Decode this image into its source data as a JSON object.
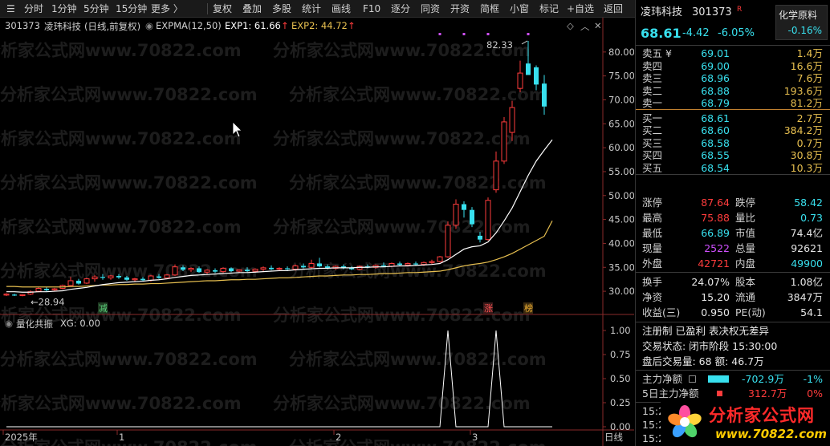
{
  "toolbar": {
    "left_items": [
      "分时",
      "1分钟",
      "5分钟",
      "15分钟",
      "更多 〉"
    ],
    "right_items": [
      "复权",
      "叠加",
      "多股",
      "统计",
      "画线",
      "F10",
      "逐分",
      "同资",
      "开资",
      "简框",
      "小窗",
      "标记",
      "+自选",
      "返回"
    ]
  },
  "legend": {
    "code": "301373",
    "name": "凌玮科技",
    "period": "(日线,前复权)",
    "indicator": "EXPMA(12,50)",
    "exp1": "EXP1: 61.66",
    "exp2": "EXP2: 44.72",
    "up_arrow": "↑"
  },
  "sub_legend": {
    "name": "量化共振",
    "value": "XG: 0.00"
  },
  "watermark": "分析家公式网www.70822.com",
  "chart_labels": {
    "high_label": "82.33",
    "low_label": "←28.94",
    "tag_jian": "减",
    "tag_zhang": "涨",
    "tag_bang": "榜"
  },
  "time_axis": [
    "2025年",
    "1",
    "2",
    "3"
  ],
  "time_axis_end": "日线",
  "chart_data": {
    "type": "candlestick",
    "price_axis": {
      "ticks": [
        30.0,
        35.0,
        40.0,
        45.0,
        50.0,
        55.0,
        60.0,
        65.0,
        70.0,
        75.0,
        80.0
      ]
    },
    "sub_axis": {
      "ticks": [
        0.0,
        0.25,
        0.5,
        0.75,
        1.0
      ]
    },
    "candles": [
      {
        "o": 29.2,
        "h": 29.6,
        "l": 29.0,
        "c": 29.4
      },
      {
        "o": 29.3,
        "h": 29.5,
        "l": 29.0,
        "c": 29.1
      },
      {
        "o": 29.1,
        "h": 29.4,
        "l": 28.94,
        "c": 29.3
      },
      {
        "o": 29.4,
        "h": 30.2,
        "l": 29.2,
        "c": 29.9
      },
      {
        "o": 30.0,
        "h": 30.8,
        "l": 29.8,
        "c": 30.6
      },
      {
        "o": 30.5,
        "h": 30.9,
        "l": 30.0,
        "c": 30.2
      },
      {
        "o": 30.3,
        "h": 30.7,
        "l": 30.0,
        "c": 30.5
      },
      {
        "o": 30.6,
        "h": 31.4,
        "l": 30.4,
        "c": 31.2
      },
      {
        "o": 31.2,
        "h": 33.0,
        "l": 31.0,
        "c": 32.2
      },
      {
        "o": 32.2,
        "h": 32.6,
        "l": 31.4,
        "c": 31.6
      },
      {
        "o": 31.7,
        "h": 32.8,
        "l": 31.5,
        "c": 32.6
      },
      {
        "o": 32.6,
        "h": 33.4,
        "l": 32.0,
        "c": 33.0
      },
      {
        "o": 33.0,
        "h": 33.6,
        "l": 32.4,
        "c": 32.8
      },
      {
        "o": 32.8,
        "h": 33.4,
        "l": 32.4,
        "c": 33.2
      },
      {
        "o": 33.2,
        "h": 33.6,
        "l": 32.6,
        "c": 32.9
      },
      {
        "o": 32.9,
        "h": 33.2,
        "l": 32.2,
        "c": 32.4
      },
      {
        "o": 32.4,
        "h": 32.8,
        "l": 32.0,
        "c": 32.6
      },
      {
        "o": 32.6,
        "h": 33.0,
        "l": 32.1,
        "c": 32.3
      },
      {
        "o": 32.3,
        "h": 33.4,
        "l": 32.0,
        "c": 33.2
      },
      {
        "o": 33.1,
        "h": 33.6,
        "l": 32.6,
        "c": 32.8
      },
      {
        "o": 32.8,
        "h": 33.6,
        "l": 32.5,
        "c": 33.4
      },
      {
        "o": 33.4,
        "h": 35.6,
        "l": 33.2,
        "c": 35.1
      },
      {
        "o": 35.0,
        "h": 35.4,
        "l": 34.2,
        "c": 34.5
      },
      {
        "o": 34.5,
        "h": 35.0,
        "l": 34.0,
        "c": 34.8
      },
      {
        "o": 34.8,
        "h": 35.2,
        "l": 33.8,
        "c": 34.0
      },
      {
        "o": 34.0,
        "h": 34.6,
        "l": 33.6,
        "c": 34.4
      },
      {
        "o": 34.4,
        "h": 34.8,
        "l": 33.8,
        "c": 34.1
      },
      {
        "o": 34.1,
        "h": 35.0,
        "l": 33.8,
        "c": 34.8
      },
      {
        "o": 34.8,
        "h": 35.0,
        "l": 34.0,
        "c": 34.2
      },
      {
        "o": 34.2,
        "h": 34.6,
        "l": 33.8,
        "c": 34.5
      },
      {
        "o": 34.5,
        "h": 35.0,
        "l": 34.0,
        "c": 34.2
      },
      {
        "o": 34.2,
        "h": 34.8,
        "l": 33.9,
        "c": 34.6
      },
      {
        "o": 34.6,
        "h": 35.2,
        "l": 34.2,
        "c": 34.9
      },
      {
        "o": 34.9,
        "h": 35.4,
        "l": 34.4,
        "c": 34.6
      },
      {
        "o": 34.6,
        "h": 35.0,
        "l": 34.3,
        "c": 34.8
      },
      {
        "o": 34.8,
        "h": 35.2,
        "l": 34.4,
        "c": 34.6
      },
      {
        "o": 34.6,
        "h": 35.6,
        "l": 34.3,
        "c": 35.3
      },
      {
        "o": 35.3,
        "h": 35.8,
        "l": 34.8,
        "c": 35.0
      },
      {
        "o": 35.0,
        "h": 36.6,
        "l": 34.8,
        "c": 35.8
      },
      {
        "o": 35.8,
        "h": 37.0,
        "l": 35.0,
        "c": 35.2
      },
      {
        "o": 35.2,
        "h": 35.6,
        "l": 34.6,
        "c": 34.8
      },
      {
        "o": 34.8,
        "h": 35.4,
        "l": 34.5,
        "c": 35.2
      },
      {
        "o": 35.2,
        "h": 35.6,
        "l": 34.6,
        "c": 34.9
      },
      {
        "o": 34.9,
        "h": 35.2,
        "l": 34.4,
        "c": 34.6
      },
      {
        "o": 34.6,
        "h": 35.4,
        "l": 34.4,
        "c": 35.2
      },
      {
        "o": 35.2,
        "h": 35.6,
        "l": 34.8,
        "c": 35.0
      },
      {
        "o": 35.0,
        "h": 35.6,
        "l": 34.7,
        "c": 35.4
      },
      {
        "o": 35.4,
        "h": 36.0,
        "l": 35.0,
        "c": 35.2
      },
      {
        "o": 35.2,
        "h": 36.0,
        "l": 35.0,
        "c": 35.8
      },
      {
        "o": 35.8,
        "h": 36.2,
        "l": 35.2,
        "c": 35.5
      },
      {
        "o": 35.5,
        "h": 36.0,
        "l": 35.2,
        "c": 35.8
      },
      {
        "o": 35.8,
        "h": 36.2,
        "l": 35.4,
        "c": 35.6
      },
      {
        "o": 35.6,
        "h": 36.2,
        "l": 35.3,
        "c": 36.0
      },
      {
        "o": 36.0,
        "h": 36.6,
        "l": 35.6,
        "c": 36.2
      },
      {
        "o": 36.2,
        "h": 37.4,
        "l": 36.0,
        "c": 37.2
      },
      {
        "o": 37.2,
        "h": 44.6,
        "l": 37.0,
        "c": 43.8
      },
      {
        "o": 43.8,
        "h": 49.2,
        "l": 43.0,
        "c": 48.2
      },
      {
        "o": 48.2,
        "h": 48.8,
        "l": 45.4,
        "c": 47.0
      },
      {
        "o": 47.0,
        "h": 47.6,
        "l": 43.4,
        "c": 44.0
      },
      {
        "o": 41.6,
        "h": 42.4,
        "l": 40.2,
        "c": 40.8
      },
      {
        "o": 40.8,
        "h": 49.6,
        "l": 40.6,
        "c": 49.0
      },
      {
        "o": 51.2,
        "h": 59.2,
        "l": 50.6,
        "c": 57.2
      },
      {
        "o": 57.2,
        "h": 66.4,
        "l": 56.6,
        "c": 65.4
      },
      {
        "o": 63.2,
        "h": 69.8,
        "l": 61.4,
        "c": 68.4
      },
      {
        "o": 72.4,
        "h": 78.2,
        "l": 71.6,
        "c": 75.6
      },
      {
        "o": 77.6,
        "h": 82.33,
        "l": 75.4,
        "c": 75.2
      },
      {
        "o": 76.8,
        "h": 77.2,
        "l": 72.0,
        "c": 73.2
      },
      {
        "o": 73.4,
        "h": 75.2,
        "l": 66.89,
        "c": 68.61
      }
    ],
    "exp1": [
      29.9,
      29.9,
      29.8,
      29.8,
      29.9,
      29.9,
      30.0,
      30.1,
      30.4,
      30.6,
      30.8,
      31.1,
      31.4,
      31.6,
      31.8,
      31.9,
      32.0,
      32.1,
      32.3,
      32.4,
      32.6,
      32.9,
      33.1,
      33.3,
      33.4,
      33.5,
      33.6,
      33.7,
      33.8,
      33.9,
      33.9,
      34.0,
      34.1,
      34.2,
      34.3,
      34.3,
      34.5,
      34.6,
      34.7,
      34.8,
      34.8,
      34.9,
      34.9,
      34.9,
      35.0,
      35.0,
      35.1,
      35.1,
      35.2,
      35.3,
      35.3,
      35.4,
      35.5,
      35.6,
      35.8,
      36.6,
      37.7,
      38.8,
      39.3,
      39.5,
      40.3,
      42.2,
      44.7,
      47.4,
      50.8,
      54.2,
      57.2,
      59.5,
      61.66
    ],
    "exp2": [
      31.0,
      31.0,
      30.9,
      30.9,
      30.9,
      30.9,
      30.9,
      30.9,
      31.0,
      31.0,
      31.1,
      31.2,
      31.3,
      31.3,
      31.4,
      31.4,
      31.5,
      31.5,
      31.6,
      31.6,
      31.7,
      31.8,
      31.9,
      32.0,
      32.1,
      32.2,
      32.2,
      32.3,
      32.4,
      32.4,
      32.5,
      32.5,
      32.6,
      32.7,
      32.8,
      32.8,
      32.9,
      33.0,
      33.1,
      33.2,
      33.2,
      33.3,
      33.4,
      33.4,
      33.5,
      33.5,
      33.6,
      33.7,
      33.7,
      33.8,
      33.9,
      33.9,
      34.0,
      34.1,
      34.2,
      34.5,
      34.9,
      35.3,
      35.6,
      35.8,
      36.1,
      36.6,
      37.2,
      37.9,
      38.8,
      39.7,
      40.6,
      41.5,
      44.72
    ],
    "signal": [
      0,
      0,
      0,
      0,
      0,
      0,
      0,
      0,
      0,
      0,
      0,
      0,
      0,
      0,
      0,
      0,
      0,
      0,
      0,
      0,
      0,
      0,
      0,
      0,
      0,
      0,
      0,
      0,
      0,
      0,
      0,
      0,
      0,
      0,
      0,
      0,
      0,
      0,
      0,
      0,
      0,
      0,
      0,
      0,
      0,
      0,
      0,
      0,
      0,
      0,
      0,
      0,
      0,
      0,
      0,
      1,
      0,
      0,
      0,
      0,
      0,
      1,
      0,
      0,
      0,
      0,
      0,
      0,
      0
    ]
  },
  "quote": {
    "name": "凌玮科技",
    "code": "301373",
    "r_badge": "R",
    "sector": "化学原料",
    "sector_change": "-0.16%",
    "price": "68.61",
    "change": "-4.42",
    "change_pct": "-6.05%",
    "sells": [
      {
        "label": "卖五 ¥",
        "price": "69.01",
        "vol": "1.4万"
      },
      {
        "label": "卖四",
        "price": "69.00",
        "vol": "16.6万"
      },
      {
        "label": "卖三",
        "price": "68.96",
        "vol": "7.6万"
      },
      {
        "label": "卖二",
        "price": "68.88",
        "vol": "193.6万"
      },
      {
        "label": "卖一",
        "price": "68.79",
        "vol": "81.2万"
      }
    ],
    "buys": [
      {
        "label": "买一",
        "price": "68.61",
        "vol": "2.7万"
      },
      {
        "label": "买二",
        "price": "68.60",
        "vol": "384.2万"
      },
      {
        "label": "买三",
        "price": "68.58",
        "vol": "0.7万"
      },
      {
        "label": "买四",
        "price": "68.55",
        "vol": "30.8万"
      },
      {
        "label": "买五",
        "price": "68.54",
        "vol": "10.3万"
      }
    ],
    "stats1": [
      {
        "l1": "涨停",
        "v1": "87.64",
        "c1": "red",
        "l2": "跌停",
        "v2": "58.42",
        "c2": "cyan"
      },
      {
        "l1": "最高",
        "v1": "75.88",
        "c1": "red",
        "l2": "量比",
        "v2": "0.73",
        "c2": "cyan"
      },
      {
        "l1": "最低",
        "v1": "66.89",
        "c1": "cyan",
        "l2": "市值",
        "v2": "74.4亿",
        "c2": "white"
      },
      {
        "l1": "现量",
        "v1": "2522",
        "c1": "purple",
        "l2": "总量",
        "v2": "92621",
        "c2": "white"
      },
      {
        "l1": "外盘",
        "v1": "42721",
        "c1": "red",
        "l2": "内盘",
        "v2": "49900",
        "c2": "cyan"
      }
    ],
    "stats2": [
      {
        "l1": "换手",
        "v1": "24.07%",
        "l2": "股本",
        "v2": "1.08亿"
      },
      {
        "l1": "净资",
        "v1": "15.20",
        "l2": "流通",
        "v2": "3847万"
      },
      {
        "l1": "收益(三)",
        "v1": "0.950",
        "l2": "PE(动)",
        "v2": "54.1"
      }
    ],
    "info_line1": "注册制 已盈利 表决权无差异",
    "info_line2": "交易状态: 闭市阶段 15:30:00",
    "info_line3_prefix": "盘后交易量: 68  额: 46.7万",
    "main_flow_label": "主力净额",
    "main_flow_value": "-702.9万",
    "main_flow_pct": "-1%",
    "five_day_label": "5日主力净额",
    "five_day_value": "312.7万",
    "five_day_pct": "0%",
    "time1": "15:2",
    "time2": "15:2",
    "time3": "15:2"
  },
  "logo": {
    "text": "分析家公式网",
    "url_text": "www.70822.com"
  },
  "colors": {
    "up": "#ff3c3c",
    "down": "#38e0ee",
    "exp1": "#ffffff",
    "exp2": "#e8c050",
    "signal": "#ffffff"
  }
}
